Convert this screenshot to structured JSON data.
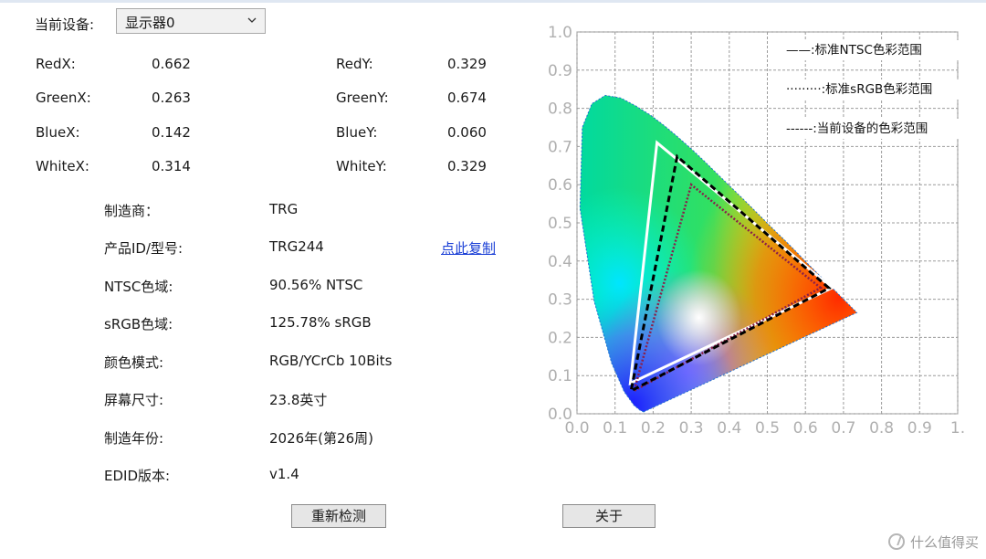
{
  "device": {
    "label": "当前设备:",
    "selected": "显示器0"
  },
  "coords": {
    "left": [
      {
        "label": "RedX:",
        "value": "0.662"
      },
      {
        "label": "GreenX:",
        "value": "0.263"
      },
      {
        "label": "BlueX:",
        "value": "0.142"
      },
      {
        "label": "WhiteX:",
        "value": "0.314"
      }
    ],
    "right": [
      {
        "label": "RedY:",
        "value": "0.329"
      },
      {
        "label": "GreenY:",
        "value": "0.674"
      },
      {
        "label": "BlueY:",
        "value": "0.060"
      },
      {
        "label": "WhiteY:",
        "value": "0.329"
      }
    ]
  },
  "info": [
    {
      "label": "制造商：",
      "value": "TRG"
    },
    {
      "label": "产品ID/型号:",
      "value": "TRG244"
    },
    {
      "label": "NTSC色域:",
      "value": "90.56% NTSC"
    },
    {
      "label": "sRGB色域:",
      "value": "125.78% sRGB"
    },
    {
      "label": "颜色模式:",
      "value": "RGB/YCrCb 10Bits"
    },
    {
      "label": "屏幕尺寸:",
      "value": "23.8英寸"
    },
    {
      "label": "制造年份:",
      "value": "2026年(第26周)"
    },
    {
      "label": "EDID版本:",
      "value": "v1.4"
    }
  ],
  "copy_link": "点此复制",
  "buttons": {
    "redetect": "重新检测",
    "about": "关于"
  },
  "watermark": "什么值得买",
  "chart_data": {
    "type": "scatter",
    "title": "",
    "xlabel": "",
    "ylabel": "",
    "xlim": [
      0,
      1
    ],
    "ylim": [
      0,
      1
    ],
    "x_ticks": [
      "0.0",
      "0.1",
      "0.2",
      "0.3",
      "0.4",
      "0.5",
      "0.6",
      "0.7",
      "0.8",
      "0.9",
      "1."
    ],
    "y_ticks": [
      "0.0",
      "0.1",
      "0.2",
      "0.3",
      "0.4",
      "0.5",
      "0.6",
      "0.7",
      "0.8",
      "0.9",
      "1.0"
    ],
    "grid": true,
    "legend_position": "top-right",
    "series": [
      {
        "name": "——:标准NTSC色彩范围",
        "style": "solid",
        "color": "#ffffff",
        "points": [
          [
            0.67,
            0.33
          ],
          [
            0.21,
            0.71
          ],
          [
            0.14,
            0.08
          ]
        ]
      },
      {
        "name": "·········:标准sRGB色彩范围",
        "style": "dotted",
        "color": "#8a1f4a",
        "points": [
          [
            0.64,
            0.33
          ],
          [
            0.3,
            0.6
          ],
          [
            0.15,
            0.06
          ]
        ]
      },
      {
        "name": "------:当前设备的色彩范围",
        "style": "dashed",
        "color": "#000000",
        "points": [
          [
            0.662,
            0.329
          ],
          [
            0.263,
            0.674
          ],
          [
            0.142,
            0.06
          ]
        ]
      }
    ],
    "spectral_locus": [
      [
        0.175,
        0.005
      ],
      [
        0.166,
        0.009
      ],
      [
        0.15,
        0.022
      ],
      [
        0.124,
        0.058
      ],
      [
        0.091,
        0.133
      ],
      [
        0.045,
        0.295
      ],
      [
        0.008,
        0.538
      ],
      [
        0.014,
        0.75
      ],
      [
        0.039,
        0.812
      ],
      [
        0.074,
        0.834
      ],
      [
        0.115,
        0.827
      ],
      [
        0.155,
        0.806
      ],
      [
        0.193,
        0.782
      ],
      [
        0.23,
        0.754
      ],
      [
        0.266,
        0.724
      ],
      [
        0.302,
        0.692
      ],
      [
        0.337,
        0.659
      ],
      [
        0.373,
        0.624
      ],
      [
        0.408,
        0.59
      ],
      [
        0.444,
        0.555
      ],
      [
        0.479,
        0.52
      ],
      [
        0.512,
        0.487
      ],
      [
        0.545,
        0.455
      ],
      [
        0.575,
        0.425
      ],
      [
        0.603,
        0.396
      ],
      [
        0.627,
        0.372
      ],
      [
        0.648,
        0.351
      ],
      [
        0.666,
        0.334
      ],
      [
        0.68,
        0.32
      ],
      [
        0.692,
        0.308
      ],
      [
        0.735,
        0.265
      ]
    ]
  }
}
